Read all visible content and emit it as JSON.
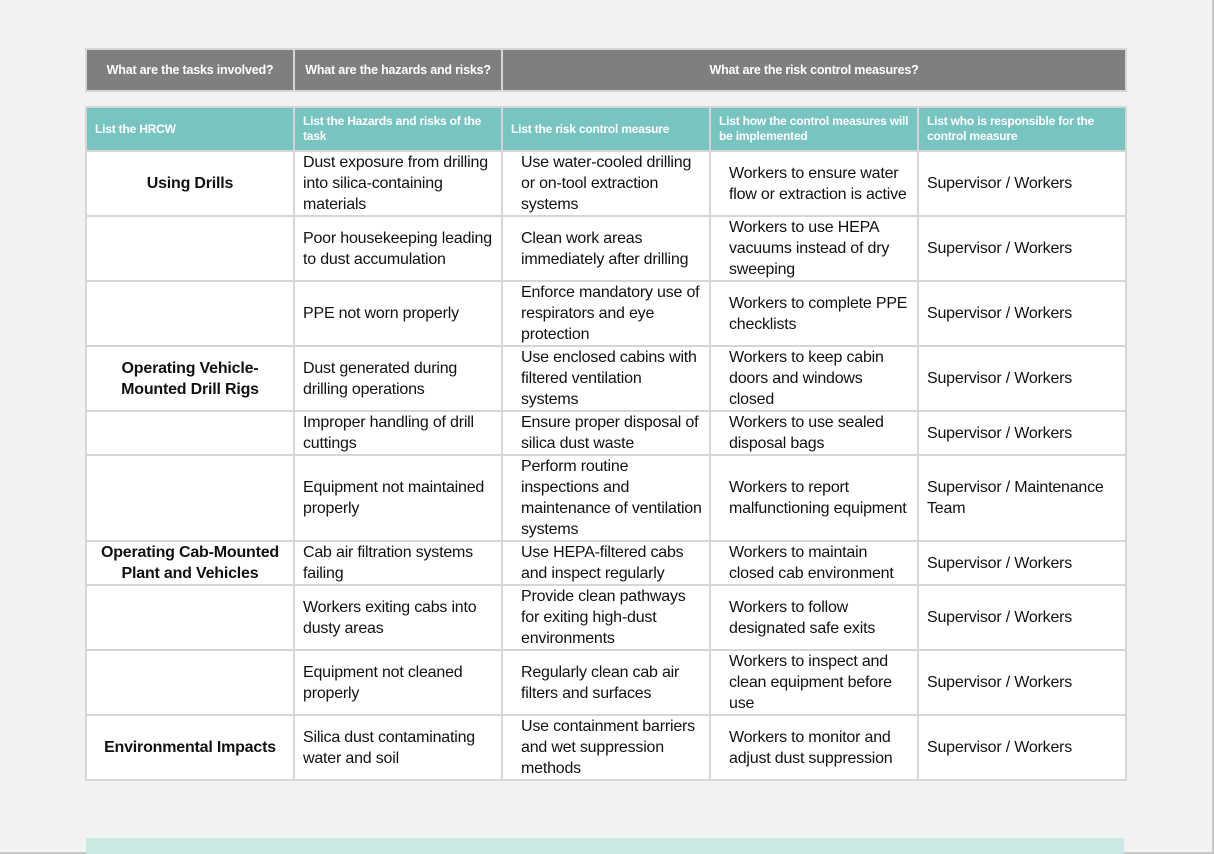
{
  "top_header": {
    "tasks": "What are the tasks involved?",
    "hazards": "What are the hazards and risks?",
    "controls": "What are the risk control measures?"
  },
  "columns": {
    "hrcw": "List the HRCW",
    "hazards": "List the Hazards and risks of the task",
    "control": "List the risk control measure",
    "implementation": "List how the control measures will be implemented",
    "responsible": "List who is responsible for the control measure"
  },
  "rows": [
    {
      "task": "Using Drills",
      "hazard": "Dust exposure from drilling into silica-containing materials",
      "control": "Use water-cooled drilling or on-tool extraction systems",
      "implementation": "Workers to ensure water flow or extraction is active",
      "responsible": "Supervisor / Workers"
    },
    {
      "task": "",
      "hazard": "Poor housekeeping leading to dust accumulation",
      "control": "Clean work areas immediately after drilling",
      "implementation": "Workers to use HEPA vacuums instead of dry sweeping",
      "responsible": "Supervisor / Workers"
    },
    {
      "task": "",
      "hazard": "PPE not worn properly",
      "control": "Enforce mandatory use of respirators and eye protection",
      "implementation": "Workers to complete PPE checklists",
      "responsible": "Supervisor / Workers"
    },
    {
      "task": "Operating Vehicle-Mounted Drill Rigs",
      "hazard": "Dust generated during drilling operations",
      "control": "Use enclosed cabins with filtered ventilation systems",
      "implementation": "Workers to keep cabin doors and windows closed",
      "responsible": "Supervisor / Workers"
    },
    {
      "task": "",
      "hazard": "Improper handling of drill cuttings",
      "control": "Ensure proper disposal of silica dust waste",
      "implementation": "Workers to use sealed disposal bags",
      "responsible": "Supervisor / Workers"
    },
    {
      "task": "",
      "hazard": "Equipment not maintained properly",
      "control": "Perform routine inspections and maintenance of ventilation systems",
      "implementation": "Workers to report malfunctioning equipment",
      "responsible": "Supervisor / Maintenance Team"
    },
    {
      "task": "Operating Cab-Mounted Plant and Vehicles",
      "hazard": "Cab air filtration systems failing",
      "control": "Use HEPA-filtered cabs and inspect regularly",
      "implementation": "Workers to maintain closed cab environment",
      "responsible": "Supervisor / Workers"
    },
    {
      "task": "",
      "hazard": "Workers exiting cabs into dusty areas",
      "control": "Provide clean pathways for exiting high-dust environments",
      "implementation": "Workers to follow designated safe exits",
      "responsible": "Supervisor / Workers"
    },
    {
      "task": "",
      "hazard": "Equipment not cleaned properly",
      "control": "Regularly clean cab air filters and surfaces",
      "implementation": "Workers to inspect and clean equipment before use",
      "responsible": "Supervisor / Workers"
    },
    {
      "task": "Environmental Impacts",
      "hazard": "Silica dust contaminating water and soil",
      "control": "Use containment barriers and wet suppression methods",
      "implementation": "Workers to monitor and adjust dust suppression",
      "responsible": "Supervisor / Workers"
    }
  ]
}
